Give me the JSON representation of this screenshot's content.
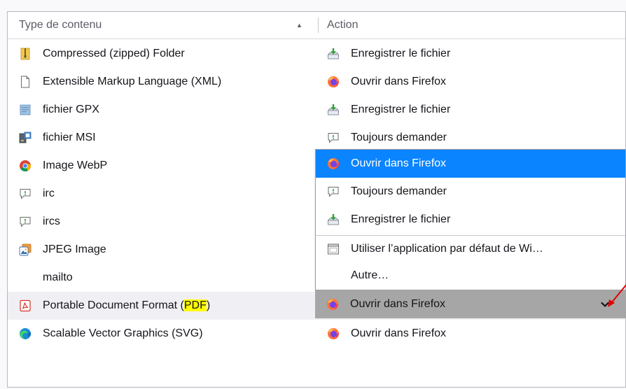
{
  "header": {
    "type_label": "Type de contenu",
    "action_label": "Action"
  },
  "rows": [
    {
      "type": "Compressed (zipped) Folder",
      "type_icon": "zip-folder-icon",
      "action": "Enregistrer le fichier",
      "action_icon": "save-file-icon"
    },
    {
      "type": "Extensible Markup Language (XML)",
      "type_icon": "blank-file-icon",
      "action": "Ouvrir dans Firefox",
      "action_icon": "firefox-icon"
    },
    {
      "type": "fichier GPX",
      "type_icon": "gpx-file-icon",
      "action": "Enregistrer le fichier",
      "action_icon": "save-file-icon"
    },
    {
      "type": "fichier MSI",
      "type_icon": "msi-installer-icon",
      "action": "Toujours demander",
      "action_icon": "ask-chat-icon"
    },
    {
      "type": "Image WebP",
      "type_icon": "chrome-icon",
      "action": "",
      "action_icon": ""
    },
    {
      "type": "irc",
      "type_icon": "ask-chat-icon",
      "action": "",
      "action_icon": ""
    },
    {
      "type": "ircs",
      "type_icon": "ask-chat-icon",
      "action": "",
      "action_icon": ""
    },
    {
      "type": "JPEG Image",
      "type_icon": "image-viewer-icon",
      "action": "",
      "action_icon": ""
    },
    {
      "type": "mailto",
      "type_icon": "",
      "action": "",
      "action_icon": ""
    },
    {
      "type_prefix": "Portable Document Format (",
      "type_highlight": "PDF",
      "type_suffix": ")",
      "type_icon": "pdf-icon",
      "action": "Ouvrir dans Firefox",
      "action_icon": "firefox-icon",
      "selected": true
    },
    {
      "type": "Scalable Vector Graphics (SVG)",
      "type_icon": "edge-icon",
      "action": "Ouvrir dans Firefox",
      "action_icon": "firefox-icon"
    }
  ],
  "dropdown": {
    "items": [
      {
        "label": "Ouvrir dans Firefox",
        "icon": "firefox-icon",
        "active": true
      },
      {
        "label": "Toujours demander",
        "icon": "ask-chat-icon"
      },
      {
        "label": "Enregistrer le fichier",
        "icon": "save-file-icon"
      },
      {
        "label": "Utiliser l’application par défaut de Wi…",
        "icon": "window-app-icon"
      },
      {
        "label": "Autre…",
        "icon": ""
      }
    ]
  },
  "colors": {
    "selection": "#0a84ff",
    "combo_bg": "#a6a6a6",
    "highlight": "#ffff00",
    "annotation": "#e00000"
  }
}
